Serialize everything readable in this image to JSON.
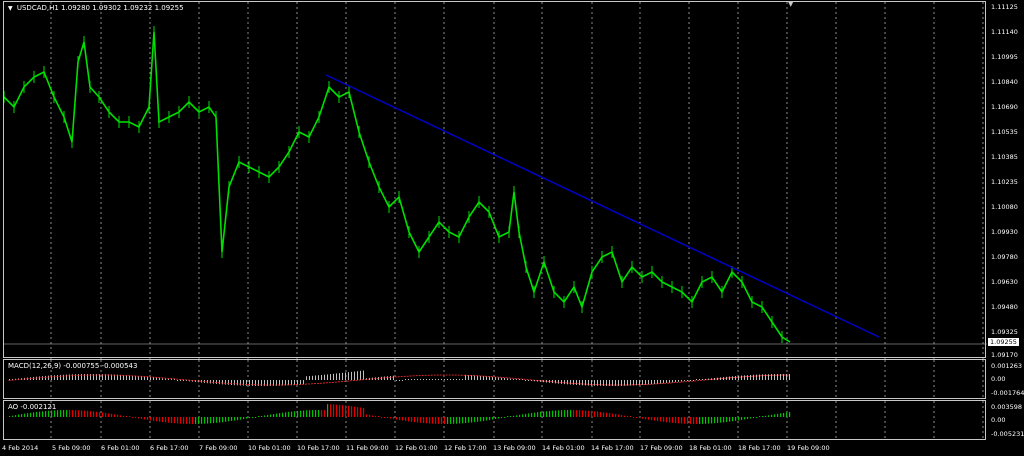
{
  "main": {
    "title": "USDCAD,H1",
    "ohlc": "1.09280 1.09302 1.09232 1.09255",
    "price_labels": [
      "1.11125",
      "1.11140",
      "1.10995",
      "1.10840",
      "1.10690",
      "1.10535",
      "1.10385",
      "1.10235",
      "1.10080",
      "1.09930",
      "1.09780",
      "1.09630",
      "1.09480",
      "1.09325",
      "1.09255",
      "1.09170"
    ],
    "current_price": "1.09255",
    "colors": {
      "bull": "#00e000",
      "bear": "#00e000",
      "trendline": "#0000c8",
      "grid": "#c8c8c8"
    }
  },
  "macd": {
    "label": "MACD(12,26,9) -0.000755 -0.000543",
    "axis": [
      "0.001263",
      "0.00",
      "-0.001764"
    ]
  },
  "ao": {
    "label": "AO -0.002121",
    "axis": [
      "0.003598",
      "0.00",
      "-0.005231"
    ]
  },
  "time_labels": [
    "4 Feb 2014",
    "5 Feb 09:00",
    "6 Feb 01:00",
    "6 Feb 17:00",
    "7 Feb 09:00",
    "10 Feb 01:00",
    "10 Feb 17:00",
    "11 Feb 09:00",
    "12 Feb 01:00",
    "12 Feb 17:00",
    "13 Feb 09:00",
    "14 Feb 01:00",
    "14 Feb 17:00",
    "17 Feb 09:00",
    "18 Feb 01:00",
    "18 Feb 17:00",
    "19 Feb 09:00"
  ]
}
